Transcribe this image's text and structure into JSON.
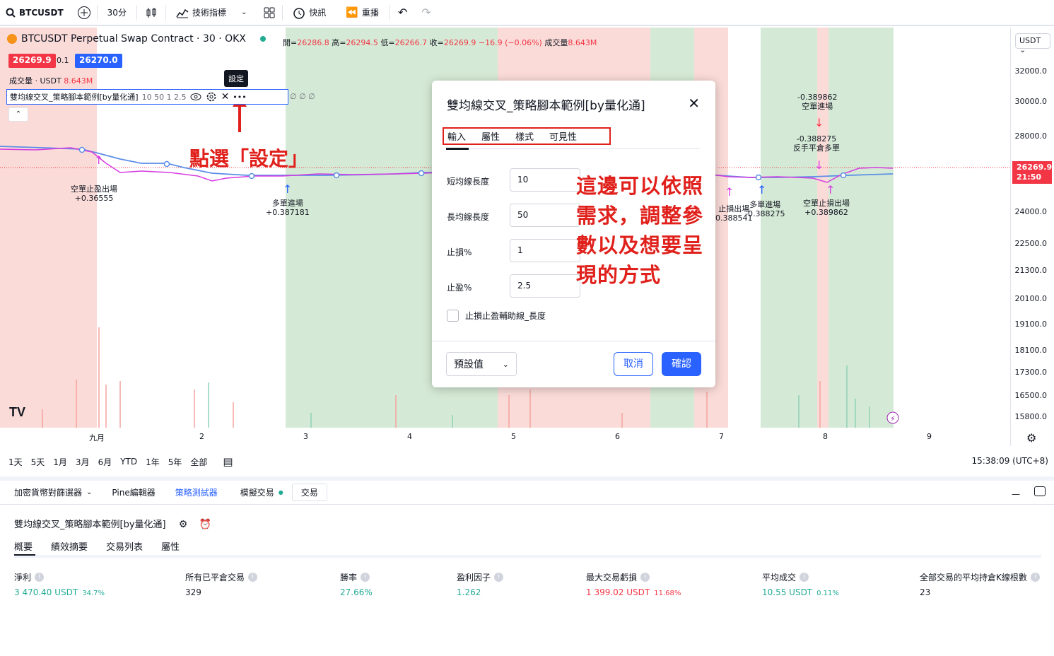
{
  "topbar": {
    "symbol": "BTCUSDT",
    "interval": "30分",
    "indicators": "技術指標",
    "alerts": "快訊",
    "replay": "重播"
  },
  "chart": {
    "title": "BTCUSDT Perpetual Swap Contract · 30 · OKX",
    "ohlc": {
      "open_lbl": "開=",
      "open": "26286.8",
      "high_lbl": "高=",
      "high": "26294.5",
      "low_lbl": "低=",
      "low": "26266.7",
      "close_lbl": "收=",
      "close": "26269.9",
      "change": "−16.9 (−0.06%)",
      "vol_lbl": "成交量",
      "vol": "8.643M"
    },
    "bid": "26269.9",
    "spread": "0.1",
    "ask": "26270.0",
    "volume_label": "成交量 · USDT",
    "volume_value": "8.643M",
    "indicator_label": "雙均線交叉_策略腳本範例[by量化通]",
    "indicator_params": "10 50 1 2.5",
    "indicator_values": "∅ ∅ ∅",
    "tooltip": "設定",
    "currency": "USDT",
    "price_ticks": [
      "32000.0",
      "30000.0",
      "28000.0",
      "24000.0",
      "22500.0",
      "21300.0",
      "20100.0",
      "19100.0",
      "18100.0",
      "17300.0",
      "16500.0",
      "15800.0"
    ],
    "last_price": "26269.9",
    "last_time": "21:50",
    "time_ticks": [
      "九月",
      "2",
      "3",
      "4",
      "5",
      "6",
      "7",
      "8",
      "9"
    ],
    "trade_labels": [
      {
        "text": "空單止盈出場",
        "value": "+0.36555"
      },
      {
        "text": "多單進場",
        "value": "+0.387181"
      },
      {
        "text": "-0.389862",
        "value": "空單進場"
      },
      {
        "text": "-0.388275",
        "value": "反手平倉多單"
      },
      {
        "text": "止損出場",
        "value": "0.388541"
      },
      {
        "text": "多單進場",
        "value": "-0.388275"
      },
      {
        "text": "空單止損出場",
        "value": "+0.389862"
      }
    ]
  },
  "annotations": {
    "settings_hint": "點選「設定」",
    "note": "這邊可以依照需求，調整參數以及想要呈現的方式"
  },
  "dialog": {
    "title": "雙均線交叉_策略腳本範例[by量化通]",
    "tabs": [
      "輸入",
      "屬性",
      "樣式",
      "可見性"
    ],
    "fields": [
      {
        "label": "短均線長度",
        "value": "10"
      },
      {
        "label": "長均線長度",
        "value": "50"
      },
      {
        "label": "止損%",
        "value": "1"
      },
      {
        "label": "止盈%",
        "value": "2.5"
      }
    ],
    "checkbox_label": "止損止盈輔助線_長度",
    "preset": "預設值",
    "cancel": "取消",
    "ok": "確認"
  },
  "ranges": [
    "1天",
    "5天",
    "1月",
    "3月",
    "6月",
    "YTD",
    "1年",
    "5年",
    "全部"
  ],
  "clock": "15:38:09 (UTC+8)",
  "bottom_tabs": [
    "加密貨幣對篩選器",
    "Pine編輯器",
    "策略測試器",
    "模擬交易",
    "交易"
  ],
  "strategy_title": "雙均線交叉_策略腳本範例[by量化通]",
  "subtabs": [
    "概要",
    "績效摘要",
    "交易列表",
    "屬性"
  ],
  "metrics": [
    {
      "label": "淨利",
      "value": "3 470.40 USDT",
      "pct": "34.7%",
      "color": "#22ab94"
    },
    {
      "label": "所有已平倉交易",
      "value": "329",
      "pct": "",
      "color": "#131722"
    },
    {
      "label": "勝率",
      "value": "27.66%",
      "pct": "",
      "color": "#22ab94"
    },
    {
      "label": "盈利因子",
      "value": "1.262",
      "pct": "",
      "color": "#22ab94"
    },
    {
      "label": "最大交易虧損",
      "value": "1 399.02 USDT",
      "pct": "11.68%",
      "color": "#f23645"
    },
    {
      "label": "平均成交",
      "value": "10.55 USDT",
      "pct": "0.11%",
      "color": "#22ab94"
    },
    {
      "label": "全部交易的平均持倉K線根數",
      "value": "23",
      "pct": "",
      "color": "#131722"
    }
  ]
}
